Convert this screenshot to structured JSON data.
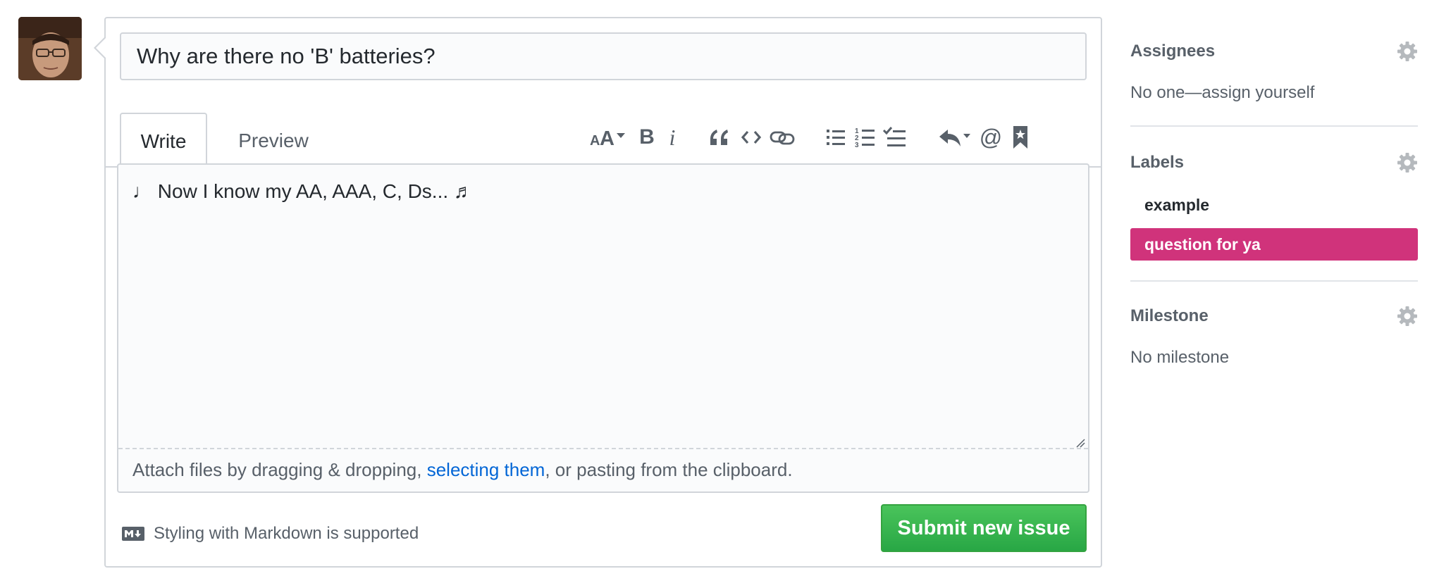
{
  "issue": {
    "title": "Why are there no 'B' batteries?",
    "body": "♩ Now I know my AA, AAA, C, Ds... ♬"
  },
  "tabs": {
    "write": "Write",
    "preview": "Preview"
  },
  "toolbar": {
    "icons": [
      "text-size-icon",
      "bold-icon",
      "italic-icon",
      "quote-icon",
      "code-icon",
      "link-icon",
      "unordered-list-icon",
      "ordered-list-icon",
      "task-list-icon",
      "reply-icon",
      "mention-icon",
      "bookmark-icon"
    ],
    "bold_glyph": "B",
    "italic_glyph": "i",
    "mention_glyph": "@"
  },
  "attach": {
    "prefix": "Attach files by dragging & dropping, ",
    "link": "selecting them",
    "suffix": ", or pasting from the clipboard."
  },
  "markdown_note": "Styling with Markdown is supported",
  "submit_label": "Submit new issue",
  "sidebar": {
    "assignees": {
      "title": "Assignees",
      "value": "No one—assign yourself"
    },
    "labels": {
      "title": "Labels",
      "items": [
        {
          "name": "example",
          "color": "#ffffff",
          "text_color": "#24292e"
        },
        {
          "name": "question for ya",
          "color": "#d0337b",
          "text_color": "#ffffff"
        }
      ]
    },
    "milestone": {
      "title": "Milestone",
      "value": "No milestone"
    }
  },
  "colors": {
    "submit": "#28a745",
    "link": "#0366d6",
    "border": "#d1d5da",
    "muted_text": "#586069"
  }
}
